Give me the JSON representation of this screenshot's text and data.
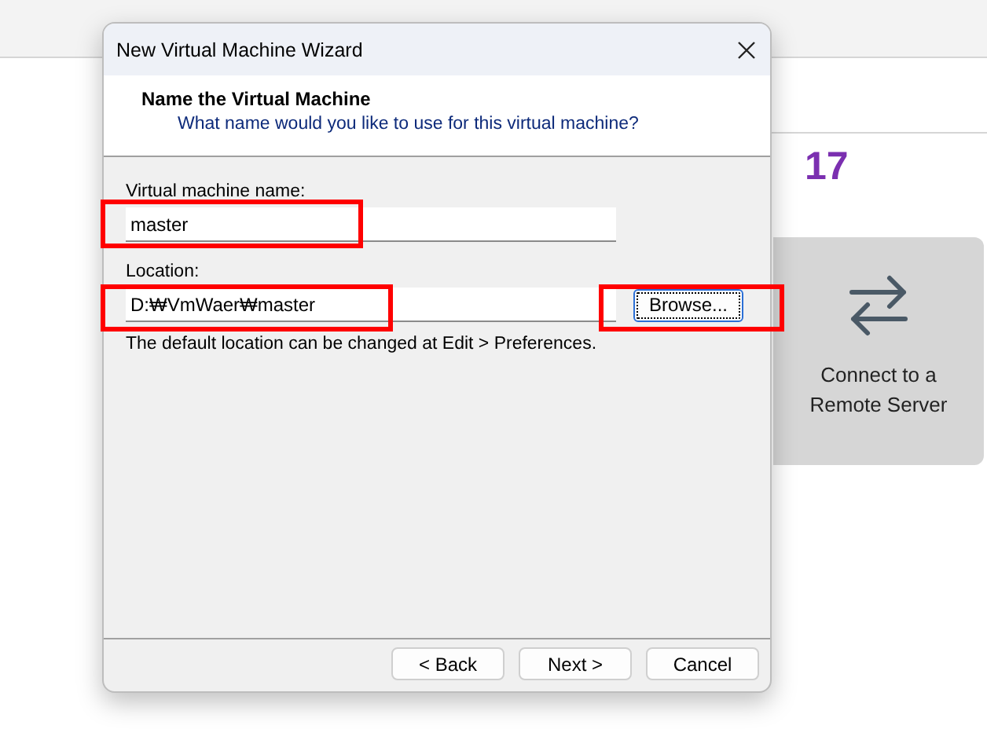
{
  "background_app": {
    "version": "17",
    "remote_card": {
      "label": "Connect to a Remote Server"
    }
  },
  "dialog": {
    "title": "New Virtual Machine Wizard",
    "heading": "Name the Virtual Machine",
    "subheading": "What name would you like to use for this virtual machine?",
    "fields": [
      {
        "label": "Virtual machine name:",
        "value": "master",
        "highlighted": true
      },
      {
        "label": "Location:",
        "value": "D:₩VmWaer₩master",
        "highlighted": true,
        "browse": {
          "label": "Browse...",
          "focused": true,
          "highlighted": true
        }
      }
    ],
    "note": "The default location can be changed at Edit > Preferences.",
    "buttons": [
      {
        "label": "< Back"
      },
      {
        "label": "Next >"
      },
      {
        "label": "Cancel"
      }
    ]
  }
}
